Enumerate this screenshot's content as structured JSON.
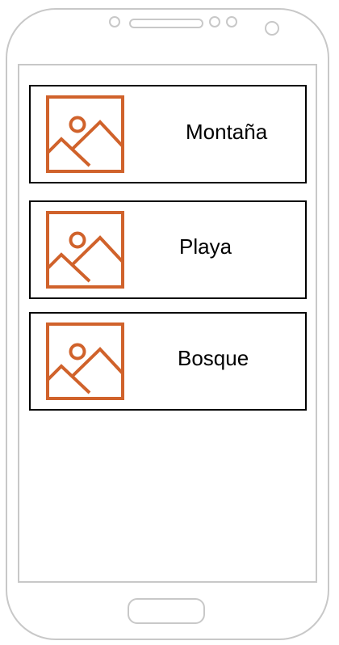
{
  "colors": {
    "accent": "#D0622B",
    "frame": "#C8C8C8",
    "card_border": "#000000"
  },
  "list": {
    "items": [
      {
        "label": "Montaña",
        "icon": "image-placeholder-icon"
      },
      {
        "label": "Playa",
        "icon": "image-placeholder-icon"
      },
      {
        "label": "Bosque",
        "icon": "image-placeholder-icon"
      }
    ]
  }
}
